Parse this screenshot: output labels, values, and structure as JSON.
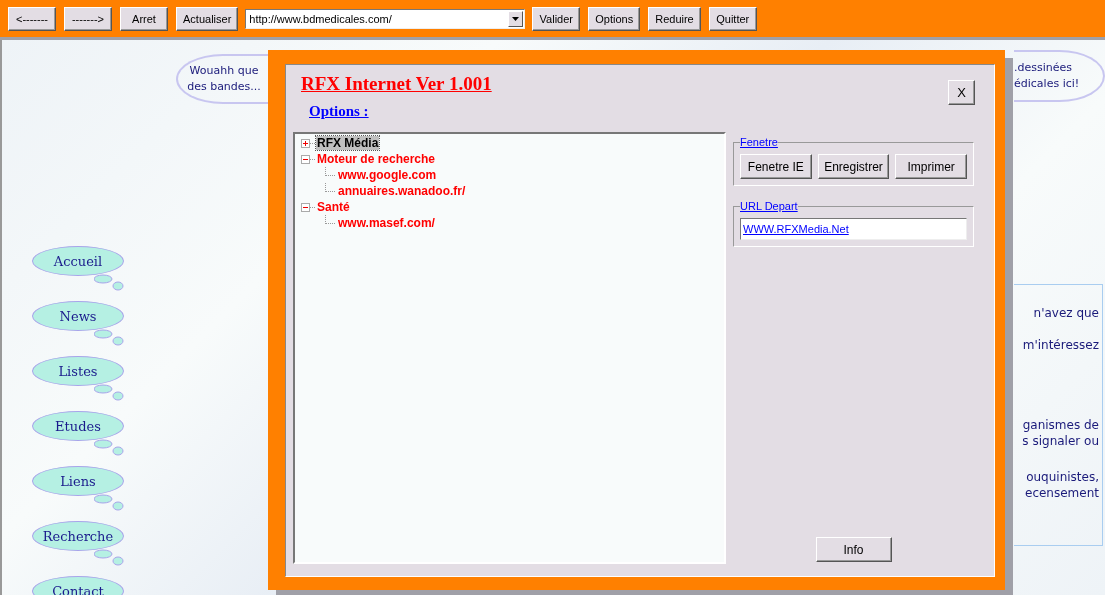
{
  "toolbar": [
    {
      "kind": "button",
      "label": "<-------"
    },
    {
      "kind": "button",
      "label": "------->"
    },
    {
      "kind": "button",
      "label": "Arret"
    },
    {
      "kind": "button",
      "label": "Actualiser"
    },
    {
      "kind": "address",
      "value": "http://www.bdmedicales.com/"
    },
    {
      "kind": "button",
      "label": "Valider"
    },
    {
      "kind": "button",
      "label": "Options"
    },
    {
      "kind": "button",
      "label": "Reduire"
    },
    {
      "kind": "button",
      "label": "Quitter"
    }
  ],
  "page": {
    "bubble_left": [
      "Wouahh que",
      "des bandes..."
    ],
    "bubble_right": [
      ".dessinées",
      "édicales ici!"
    ],
    "nav": [
      "Accueil",
      "News",
      "Listes",
      "Etudes",
      "Liens",
      "Recherche",
      "Contact"
    ],
    "panel_paragraphs": [
      [
        "n'avez que"
      ],
      [
        "m'intéressez"
      ],
      [
        "ganismes de",
        "s signaler ou"
      ],
      [
        "ouquinistes,",
        "ecensement"
      ]
    ]
  },
  "dialog": {
    "title": "RFX Internet Ver 1.001",
    "close": "X",
    "subtitle": "Options :",
    "tree": [
      {
        "label": "RFX Média",
        "expanded": false,
        "selected": true
      },
      {
        "label": "Moteur de recherche",
        "expanded": true,
        "selected": false,
        "children": [
          {
            "label": "www.google.com",
            "selected": false
          },
          {
            "label": "annuaires.wanadoo.fr/",
            "selected": false
          }
        ]
      },
      {
        "label": "Santé",
        "expanded": true,
        "selected": false,
        "children": [
          {
            "label": "www.masef.com/",
            "selected": false
          }
        ]
      }
    ],
    "groups": [
      {
        "kind": "buttons",
        "title": "Fenetre",
        "buttons": [
          "Fenetre IE",
          "Enregistrer",
          "Imprimer"
        ]
      },
      {
        "kind": "field",
        "title": "URL Depart",
        "value": "WWW.RFXMedia.Net"
      }
    ],
    "info": "Info"
  }
}
